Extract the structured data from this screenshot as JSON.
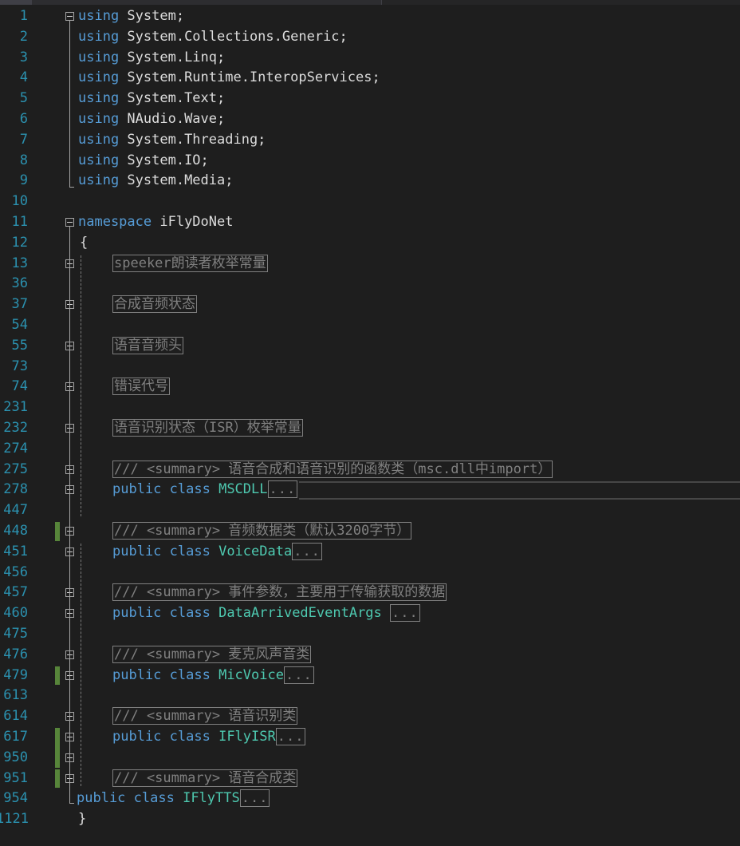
{
  "lines": [
    {
      "n": "1",
      "segs": [
        {
          "t": "using",
          "c": "kw"
        },
        {
          "t": " System;",
          "c": "plain"
        }
      ]
    },
    {
      "n": "2",
      "segs": [
        {
          "t": "using",
          "c": "kw"
        },
        {
          "t": " System.Collections.Generic;",
          "c": "plain"
        }
      ]
    },
    {
      "n": "3",
      "segs": [
        {
          "t": "using",
          "c": "kw"
        },
        {
          "t": " System.Linq;",
          "c": "plain"
        }
      ]
    },
    {
      "n": "4",
      "segs": [
        {
          "t": "using",
          "c": "kw"
        },
        {
          "t": " System.Runtime.InteropServices;",
          "c": "plain"
        }
      ]
    },
    {
      "n": "5",
      "segs": [
        {
          "t": "using",
          "c": "kw"
        },
        {
          "t": " System.Text;",
          "c": "plain"
        }
      ]
    },
    {
      "n": "6",
      "segs": [
        {
          "t": "using",
          "c": "kw"
        },
        {
          "t": " NAudio.Wave;",
          "c": "plain"
        }
      ]
    },
    {
      "n": "7",
      "segs": [
        {
          "t": "using",
          "c": "kw"
        },
        {
          "t": " System.Threading;",
          "c": "plain"
        }
      ]
    },
    {
      "n": "8",
      "segs": [
        {
          "t": "using",
          "c": "kw"
        },
        {
          "t": " System.IO;",
          "c": "plain"
        }
      ]
    },
    {
      "n": "9",
      "segs": [
        {
          "t": "using",
          "c": "kw"
        },
        {
          "t": " System.Media;",
          "c": "plain"
        }
      ]
    },
    {
      "n": "10",
      "segs": []
    },
    {
      "n": "11",
      "segs": [
        {
          "t": "namespace",
          "c": "kw"
        },
        {
          "t": " iFlyDoNet",
          "c": "plain"
        }
      ]
    },
    {
      "n": "12",
      "segs": [
        {
          "t": "{",
          "c": "plain"
        }
      ]
    },
    {
      "n": "13",
      "segs": [
        {
          "t": "speeker朗读者枚举常量",
          "c": "collapsed"
        }
      ]
    },
    {
      "n": "36",
      "segs": []
    },
    {
      "n": "37",
      "segs": [
        {
          "t": "合成音频状态",
          "c": "collapsed"
        }
      ]
    },
    {
      "n": "54",
      "segs": []
    },
    {
      "n": "55",
      "segs": [
        {
          "t": "语音音频头",
          "c": "collapsed"
        }
      ]
    },
    {
      "n": "73",
      "segs": []
    },
    {
      "n": "74",
      "segs": [
        {
          "t": "错误代号",
          "c": "collapsed"
        }
      ]
    },
    {
      "n": "231",
      "segs": []
    },
    {
      "n": "232",
      "segs": [
        {
          "t": "语音识别状态（ISR）枚举常量",
          "c": "collapsed"
        }
      ]
    },
    {
      "n": "274",
      "segs": []
    },
    {
      "n": "275",
      "segs": [
        {
          "t": "/// <summary> 语音合成和语音识别的函数类（msc.dll中import）",
          "c": "collapsed"
        }
      ]
    },
    {
      "n": "278",
      "segs": [
        {
          "t": "public class",
          "c": "kw"
        },
        {
          "t": " ",
          "c": "plain"
        },
        {
          "t": "MSCDLL",
          "c": "type"
        },
        {
          "t": "...",
          "c": "collapsed dots"
        }
      ]
    },
    {
      "n": "447",
      "segs": []
    },
    {
      "n": "448",
      "segs": [
        {
          "t": "/// <summary> 音频数据类（默认3200字节）",
          "c": "collapsed"
        }
      ]
    },
    {
      "n": "451",
      "segs": [
        {
          "t": "public class",
          "c": "kw"
        },
        {
          "t": " ",
          "c": "plain"
        },
        {
          "t": "VoiceData",
          "c": "type"
        },
        {
          "t": "...",
          "c": "collapsed dots"
        }
      ]
    },
    {
      "n": "456",
      "segs": []
    },
    {
      "n": "457",
      "segs": [
        {
          "t": "/// <summary> 事件参数，主要用于传输获取的数据",
          "c": "collapsed"
        }
      ]
    },
    {
      "n": "460",
      "segs": [
        {
          "t": "public class",
          "c": "kw"
        },
        {
          "t": " ",
          "c": "plain"
        },
        {
          "t": "DataArrivedEventArgs",
          "c": "type"
        },
        {
          "t": " ",
          "c": "plain"
        },
        {
          "t": "...",
          "c": "collapsed dots"
        }
      ]
    },
    {
      "n": "475",
      "segs": []
    },
    {
      "n": "476",
      "segs": [
        {
          "t": "/// <summary> 麦克风声音类",
          "c": "collapsed"
        }
      ]
    },
    {
      "n": "479",
      "segs": [
        {
          "t": "public class",
          "c": "kw"
        },
        {
          "t": " ",
          "c": "plain"
        },
        {
          "t": "MicVoice",
          "c": "type"
        },
        {
          "t": "...",
          "c": "collapsed dots"
        }
      ]
    },
    {
      "n": "613",
      "segs": []
    },
    {
      "n": "614",
      "segs": [
        {
          "t": "/// <summary> 语音识别类",
          "c": "collapsed"
        }
      ]
    },
    {
      "n": "617",
      "segs": [
        {
          "t": "public class",
          "c": "kw"
        },
        {
          "t": " ",
          "c": "plain"
        },
        {
          "t": "IFlyISR",
          "c": "type"
        },
        {
          "t": "...",
          "c": "collapsed dots"
        }
      ]
    },
    {
      "n": "950",
      "segs": []
    },
    {
      "n": "951",
      "segs": [
        {
          "t": "/// <summary> 语音合成类",
          "c": "collapsed"
        }
      ]
    },
    {
      "n": "954",
      "segs": [
        {
          "t": "public class",
          "c": "kw"
        },
        {
          "t": " ",
          "c": "plain"
        },
        {
          "t": "IFlyTTS",
          "c": "type"
        },
        {
          "t": "...",
          "c": "collapsed dots"
        }
      ]
    },
    {
      "n": "1121",
      "segs": [
        {
          "t": "}",
          "c": "plain"
        }
      ]
    }
  ],
  "colors": {
    "background": "#1e1e1e",
    "line_number": "#2b91af",
    "keyword": "#569cd6",
    "type": "#4ec9b0",
    "text": "#dcdcdc",
    "collapsed": "#808080",
    "change_marker": "#57853a"
  }
}
